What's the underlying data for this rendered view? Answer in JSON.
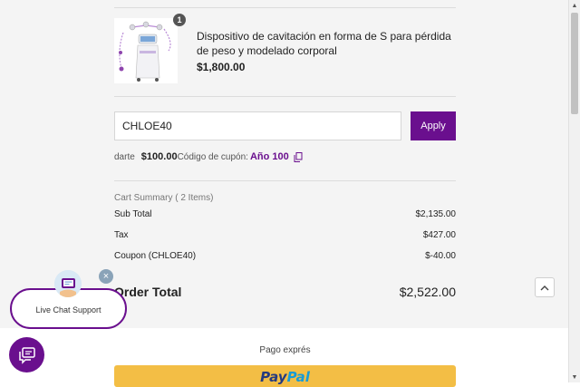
{
  "product": {
    "name": "Dispositivo de cavitación en forma de S para pérdida de peso y modelado corporal",
    "price": "$1,800.00",
    "quantity": "1",
    "image_icon": "cavitation-machine-image"
  },
  "coupon": {
    "input_value": "CHLOE40",
    "apply_label": "Apply",
    "savings_prefix": "darte",
    "savings_amount": "$100.00",
    "code_label": "Código de cupón:",
    "code_value": "Año 100",
    "copy_icon": "copy-icon"
  },
  "summary": {
    "title": "Cart Summary ( 2 Items)",
    "rows": [
      {
        "label": "Sub Total",
        "value": "$2,135.00"
      },
      {
        "label": "Tax",
        "value": "$427.00"
      },
      {
        "label": "Coupon (CHLOE40)",
        "value": "$-40.00"
      }
    ],
    "order_total_label": "Order Total",
    "order_total_value": "$2,522.00"
  },
  "express": {
    "label": "Pago exprés",
    "paypal_pay": "Pay",
    "paypal_pal": "Pal"
  },
  "chat": {
    "bubble_text": "Live Chat Support",
    "close_glyph": "×"
  },
  "colors": {
    "brand_purple": "#6a0f8e",
    "paypal_yellow": "#f3be45",
    "page_bg": "#f4f4f4"
  }
}
